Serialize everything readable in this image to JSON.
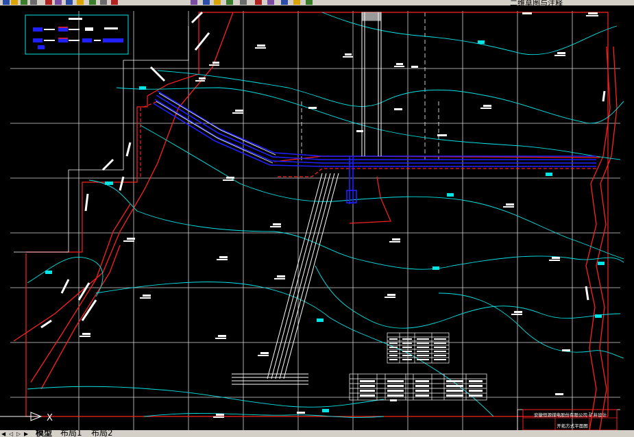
{
  "toolbar": {
    "workspace_label": "二维草图与注释",
    "buttons": [
      "new-icon",
      "open-icon",
      "save-icon",
      "print-icon",
      "cut-icon",
      "copy-icon",
      "paste-icon",
      "match-properties-icon",
      "undo-icon",
      "redo-icon",
      "pan-icon",
      "zoom-realtime-icon",
      "zoom-window-icon",
      "zoom-previous-icon",
      "properties-icon",
      "design-center-icon",
      "tool-palette-icon",
      "sheet-set-icon",
      "markup-icon",
      "calculator-icon",
      "help-icon"
    ]
  },
  "drawing": {
    "title_block": {
      "company": "安徽恒源煤电股份有限公司 矿井设计",
      "drawing_name": "开拓方式平面图"
    },
    "colors": {
      "background": "#000000",
      "grid": "#ffffff",
      "contour": "#00e5e5",
      "boundary": "#ff2020",
      "roadway": "#2020ff",
      "elevation_marker": "#00ffff"
    }
  },
  "ucs": {
    "x_label": "X"
  },
  "tabs": {
    "model": "模型",
    "layout1": "布局1",
    "layout2": "布局2",
    "nav_first": "◀",
    "nav_prev": "◁",
    "nav_next": "▷",
    "nav_last": "▶"
  }
}
